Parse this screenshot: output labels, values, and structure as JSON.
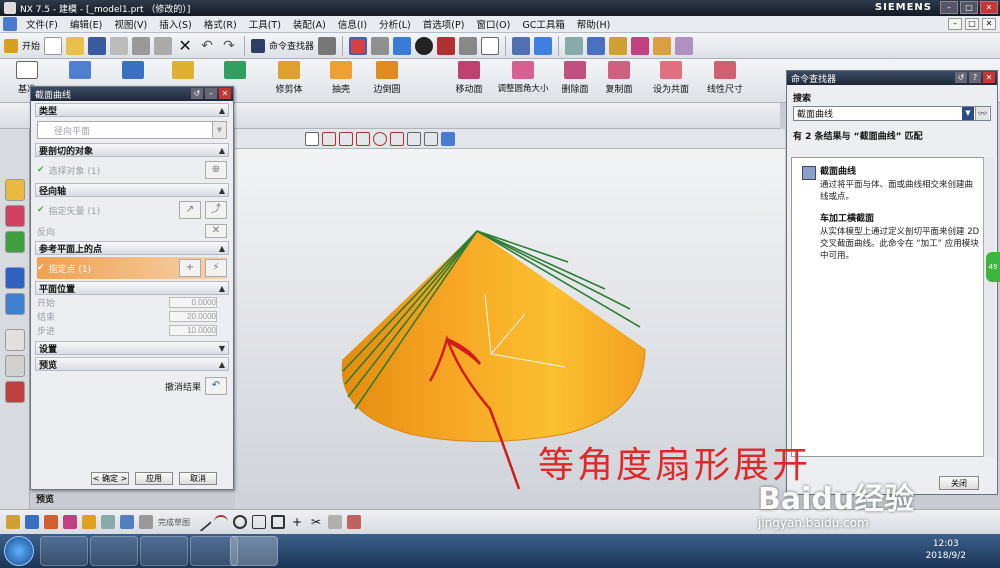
{
  "window": {
    "title": "NX 7.5 - 建模 - [_model1.prt （修改的）]",
    "brand": "SIEMENS"
  },
  "menu": [
    "文件(F)",
    "编辑(E)",
    "视图(V)",
    "插入(S)",
    "格式(R)",
    "工具(T)",
    "装配(A)",
    "信息(I)",
    "分析(L)",
    "首选项(P)",
    "窗口(O)",
    "GC工具箱",
    "帮助(H)"
  ],
  "toolbar1": {
    "start": "开始",
    "command_finder": "命令查找器"
  },
  "toolbar2": [
    "基准",
    "修剪体",
    "抽壳",
    "边倒圆",
    "移动面",
    "调整圆角大小",
    "删除面",
    "复制面",
    "设为共面",
    "线性尺寸"
  ],
  "dialog": {
    "title": "截面曲线",
    "type_section": "类型",
    "type_value": "径向平面",
    "objects_section": "要剖切的对象",
    "select_object": "选择对象 (1)",
    "axis_section": "径向轴",
    "specify_vector": "指定矢量 (1)",
    "reverse": "反向",
    "point_section": "参考平面上的点",
    "specify_point": "指定点 (1)",
    "plane_pos_section": "平面位置",
    "start_label": "开始",
    "start_val": "0.0000",
    "end_label": "结束",
    "end_val": "20.0000",
    "step_label": "步进",
    "step_val": "10.0000",
    "settings_section": "设置",
    "preview_section": "预览",
    "undo_result": "撤消结果",
    "ok": "< 确定 >",
    "apply": "应用",
    "cancel": "取消"
  },
  "preview_label": "预览",
  "finder": {
    "title": "命令查找器",
    "search_label": "搜索",
    "search_value": "截面曲线",
    "results_header": "有 2 条结果与 “截面曲线” 匹配",
    "results": [
      {
        "title": "截面曲线",
        "desc": "通过将平面与体、面或曲线相交来创建曲线或点。"
      },
      {
        "title": "车加工横截面",
        "desc": "从实体模型上通过定义剖切平面来创建 2D 交叉截面曲线。此命令在 “加工” 应用模块中可用。"
      }
    ],
    "close": "关闭"
  },
  "status": {
    "complete_sketch": "完成草图"
  },
  "annotation": "等角度扇形展开",
  "watermark": {
    "brand": "Baidu经验",
    "url": "jingyan.baidu.com"
  },
  "clock": {
    "time": "12:03",
    "date": "2018/9/2"
  },
  "colors": {
    "cone": "#f5a623",
    "cone_dark": "#e08a10",
    "lines": "#2e7d32",
    "arrow": "#d01c1c"
  }
}
